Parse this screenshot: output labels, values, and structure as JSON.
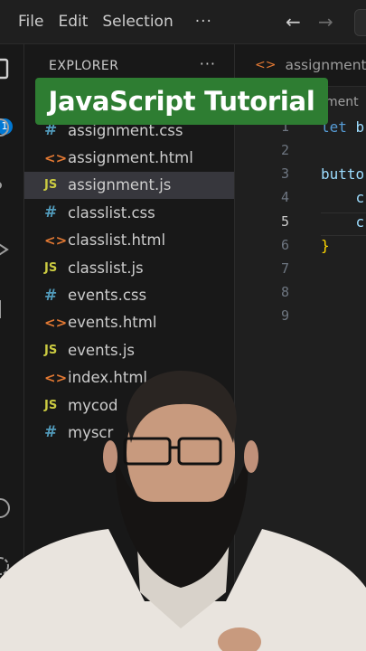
{
  "menubar": {
    "items": [
      "File",
      "Edit",
      "Selection"
    ],
    "more": "···"
  },
  "activity_bar": {
    "badge_count": "1"
  },
  "sidebar": {
    "header": "EXPLORER",
    "more": "···",
    "files": [
      {
        "name": "assignment.css",
        "type": "css",
        "icon": "#"
      },
      {
        "name": "assignment.html",
        "type": "html",
        "icon": "<>"
      },
      {
        "name": "assignment.js",
        "type": "js",
        "icon": "JS",
        "active": true
      },
      {
        "name": "classlist.css",
        "type": "css",
        "icon": "#"
      },
      {
        "name": "classlist.html",
        "type": "html",
        "icon": "<>"
      },
      {
        "name": "classlist.js",
        "type": "js",
        "icon": "JS"
      },
      {
        "name": "events.css",
        "type": "css",
        "icon": "#"
      },
      {
        "name": "events.html",
        "type": "html",
        "icon": "<>"
      },
      {
        "name": "events.js",
        "type": "js",
        "icon": "JS"
      },
      {
        "name": "index.html",
        "type": "html",
        "icon": "<>"
      },
      {
        "name": "mycod",
        "type": "js",
        "icon": "JS"
      },
      {
        "name": "myscr",
        "type": "css",
        "icon": "#"
      }
    ]
  },
  "editor": {
    "tab": {
      "label": "assignment.h",
      "icon": "<>"
    },
    "breadcrumb": "ment",
    "line_numbers": [
      "1",
      "2",
      "3",
      "4",
      "5",
      "6",
      "7",
      "8",
      "9"
    ],
    "current_line": "5",
    "code": {
      "line1_kw": "let",
      "line1_ident": "b",
      "line3_ident": "butto",
      "line4_ident": "c",
      "line5_ident": "c",
      "line6_brace": "}"
    }
  },
  "overlay": {
    "title": "JavaScript Tutorial",
    "banner_color": "#2e7d32"
  },
  "colors": {
    "accent": "#0078d4",
    "css_icon": "#519aba",
    "html_icon": "#e37933",
    "js_icon": "#cbcb41"
  }
}
